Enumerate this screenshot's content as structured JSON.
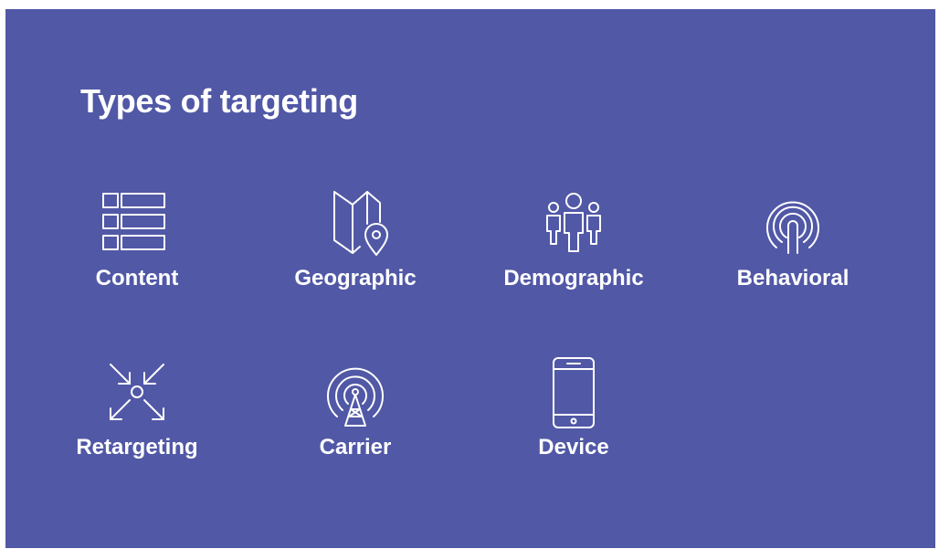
{
  "title": "Types of targeting",
  "colors": {
    "background": "#5158a6",
    "foreground": "#ffffff"
  },
  "items": [
    {
      "label": "Content",
      "icon": "content-grid-icon"
    },
    {
      "label": "Geographic",
      "icon": "map-pin-icon"
    },
    {
      "label": "Demographic",
      "icon": "people-icon"
    },
    {
      "label": "Behavioral",
      "icon": "fingerprint-touch-icon"
    },
    {
      "label": "Retargeting",
      "icon": "arrows-converge-icon"
    },
    {
      "label": "Carrier",
      "icon": "signal-tower-icon"
    },
    {
      "label": "Device",
      "icon": "smartphone-icon"
    }
  ]
}
